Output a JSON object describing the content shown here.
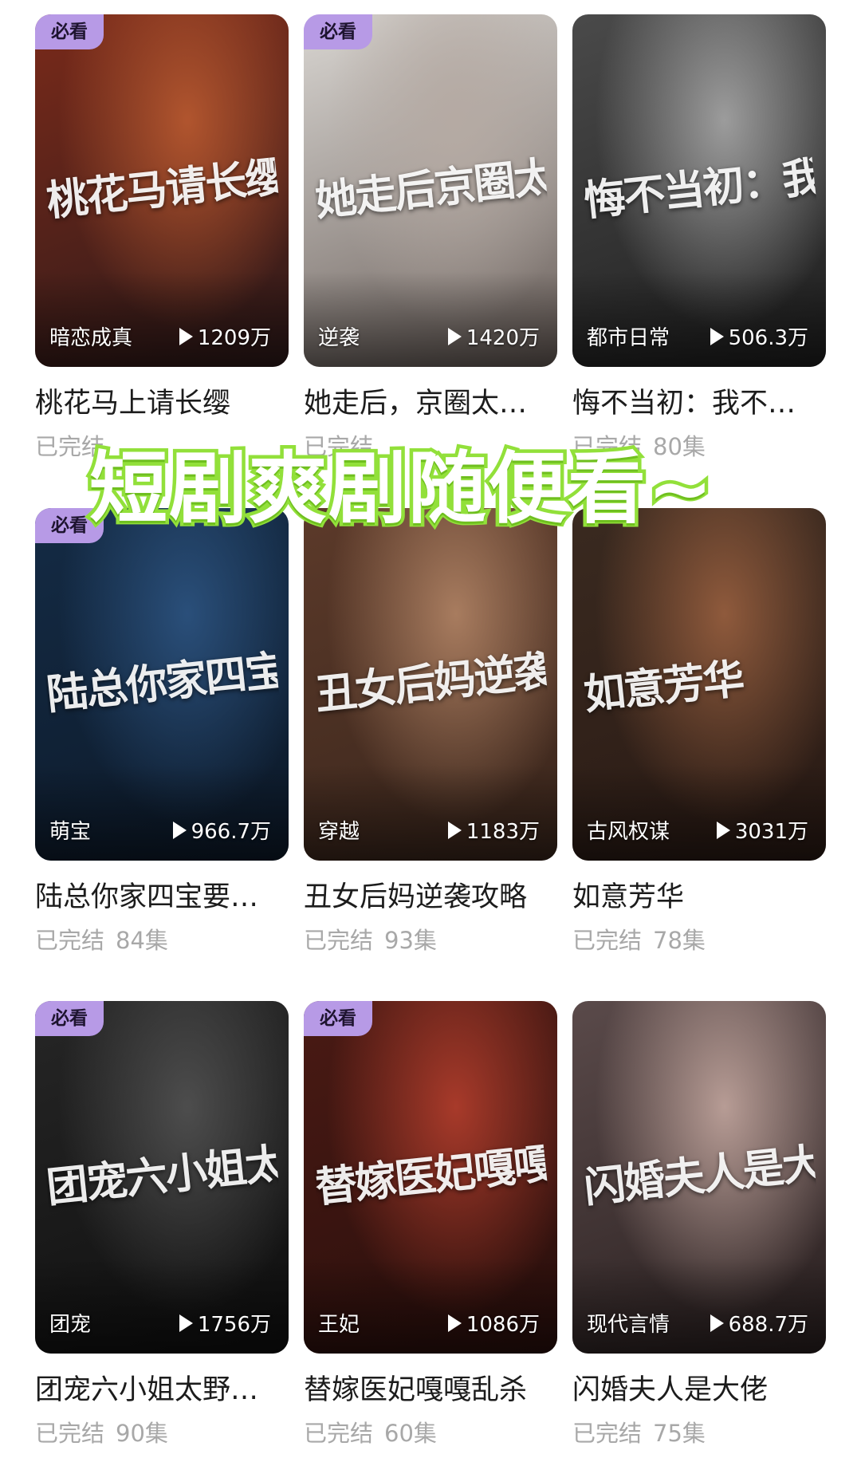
{
  "overlay": {
    "text": "短剧爽剧随便看~"
  },
  "badge_label": "必看",
  "status_label": "已完结",
  "cards": [
    {
      "badge": true,
      "poster_title": "桃花马请长缨",
      "genre": "暗恋成真",
      "plays": "1209万",
      "title": "桃花马上请长缨",
      "status": "已完结",
      "episodes": "",
      "colors": [
        "#7a2a1a",
        "#b1552e",
        "#2e1a1a"
      ]
    },
    {
      "badge": true,
      "poster_title": "她走后京圈太子爷急疯了",
      "genre": "逆袭",
      "plays": "1420万",
      "title": "她走后，京圈太…",
      "status": "已完结",
      "episodes": "",
      "colors": [
        "#d9d6d2",
        "#b5aaa3",
        "#6a5f5a"
      ]
    },
    {
      "badge": false,
      "poster_title": "悔不当初：我不追了你哭什么",
      "genre": "都市日常",
      "plays": "506.3万",
      "title": "悔不当初：我不…",
      "status": "已完结",
      "episodes": "80集",
      "colors": [
        "#4a4a4a",
        "#9c9c9c",
        "#1f1f1f"
      ]
    },
    {
      "badge": true,
      "poster_title": "陆总你家四宝要逆天",
      "genre": "萌宝",
      "plays": "966.7万",
      "title": "陆总你家四宝要…",
      "status": "已完结",
      "episodes": "84集",
      "colors": [
        "#142b45",
        "#2a4f7a",
        "#0d1a2a"
      ]
    },
    {
      "badge": false,
      "poster_title": "丑女后妈逆袭攻略",
      "genre": "穿越",
      "plays": "1183万",
      "title": "丑女后妈逆袭攻略",
      "status": "已完结",
      "episodes": "93集",
      "colors": [
        "#5c3a2a",
        "#a87c5f",
        "#3a261c"
      ]
    },
    {
      "badge": false,
      "poster_title": "如意芳华",
      "genre": "古风权谋",
      "plays": "3031万",
      "title": "如意芳华",
      "status": "已完结",
      "episodes": "78集",
      "colors": [
        "#3a2a20",
        "#8f5a3c",
        "#2a1a14"
      ]
    },
    {
      "badge": true,
      "poster_title": "团宠六小姐太野了",
      "genre": "团宠",
      "plays": "1756万",
      "title": "团宠六小姐太野…",
      "status": "已完结",
      "episodes": "90集",
      "colors": [
        "#262626",
        "#4d4d4d",
        "#0f0f0f"
      ]
    },
    {
      "badge": true,
      "poster_title": "替嫁医妃嘎嘎乱杀",
      "genre": "王妃",
      "plays": "1086万",
      "title": "替嫁医妃嘎嘎乱杀",
      "status": "已完结",
      "episodes": "60集",
      "colors": [
        "#4a1a14",
        "#a83a2a",
        "#2a0f0c"
      ]
    },
    {
      "badge": false,
      "poster_title": "闪婚夫人是大佬",
      "genre": "现代言情",
      "plays": "688.7万",
      "title": "闪婚夫人是大佬",
      "status": "已完结",
      "episodes": "75集",
      "colors": [
        "#5a4a4a",
        "#b79c95",
        "#2a2020"
      ]
    }
  ]
}
